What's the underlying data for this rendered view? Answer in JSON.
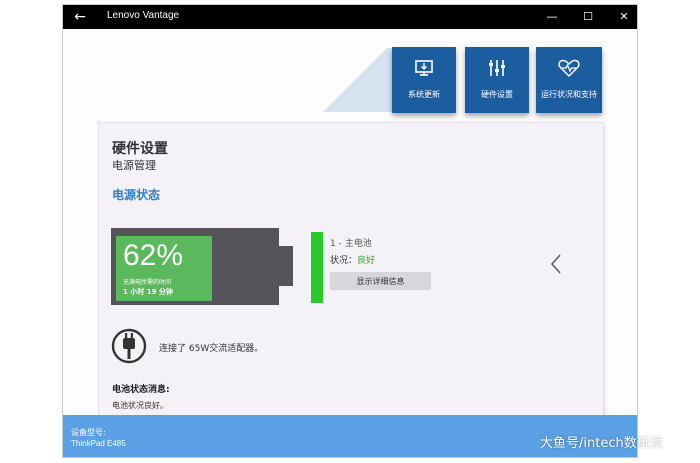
{
  "window": {
    "title": "Lenovo Vantage",
    "back_glyph": "←",
    "minimize_glyph": "—",
    "maximize_glyph": "☐",
    "close_glyph": "✕"
  },
  "tiles": [
    {
      "label": "系统更新",
      "icon": "system-update-icon"
    },
    {
      "label": "硬件设置",
      "icon": "sliders-icon"
    },
    {
      "label": "运行状况和支持",
      "icon": "heart-pulse-icon"
    }
  ],
  "panel": {
    "title": "硬件设置",
    "subtitle": "电源管理",
    "section": "电源状态"
  },
  "battery": {
    "percent_text": "62%",
    "level": 0.62,
    "charge_label": "充满电所需的时间",
    "charge_time": "1 小时 19 分钟",
    "name": "1 - 主电池",
    "status_label": "状况：",
    "status_value": "良好",
    "details_button": "显示详细信息",
    "fill_color": "#5cb85c",
    "indicator_color": "#2cc92c"
  },
  "adapter": {
    "icon": "power-plug-icon",
    "text": "连接了 65W交流适配器。"
  },
  "messages": {
    "heading": "电池状态消息:",
    "body": "电池状况良好。"
  },
  "device": {
    "label": "设备型号:",
    "model": "ThinkPad E485"
  },
  "watermark": "大鱼号/intech数玩派",
  "colors": {
    "accent": "#1c5da0",
    "section_heading": "#2f7fc1",
    "footer": "#5ba0e4"
  }
}
